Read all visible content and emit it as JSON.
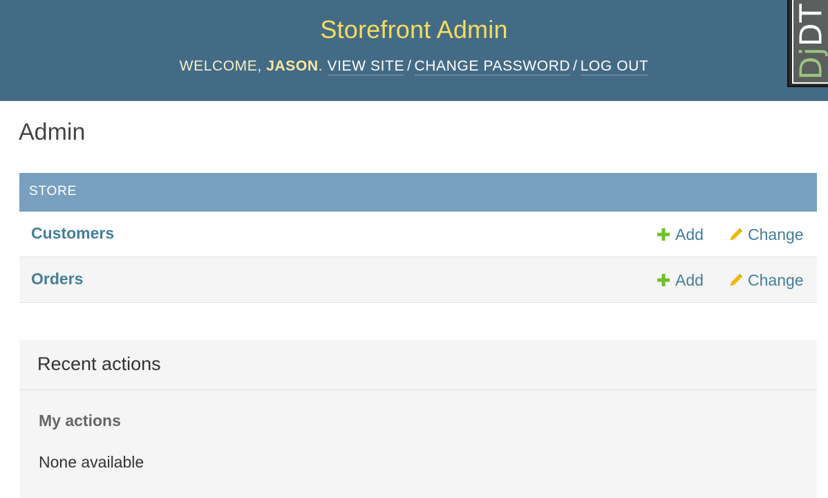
{
  "header": {
    "site_name": "Storefront Admin",
    "welcome": "WELCOME,",
    "user_name": "JASON",
    "user_suffix": ".",
    "view_site": "VIEW SITE",
    "change_password": "CHANGE PASSWORD",
    "log_out": "LOG OUT",
    "separator": "/"
  },
  "debug_toolbar": {
    "handle_dj": "Dj",
    "handle_dt": "DT"
  },
  "page_title": "Admin",
  "app_module": {
    "caption": "STORE",
    "models": [
      {
        "name": "Customers",
        "add_label": "Add",
        "change_label": "Change"
      },
      {
        "name": "Orders",
        "add_label": "Add",
        "change_label": "Change"
      }
    ]
  },
  "recent_actions": {
    "title": "Recent actions",
    "my_actions": "My actions",
    "empty_text": "None available"
  },
  "colors": {
    "header_bg": "#446b86",
    "site_name": "#f5dd5d",
    "caption_bg": "#79a1bf",
    "link": "#447e9b",
    "add_icon": "#70bf2b",
    "change_icon": "#efb80b"
  },
  "icons": {
    "add": "plus-icon",
    "change": "pencil-icon"
  }
}
